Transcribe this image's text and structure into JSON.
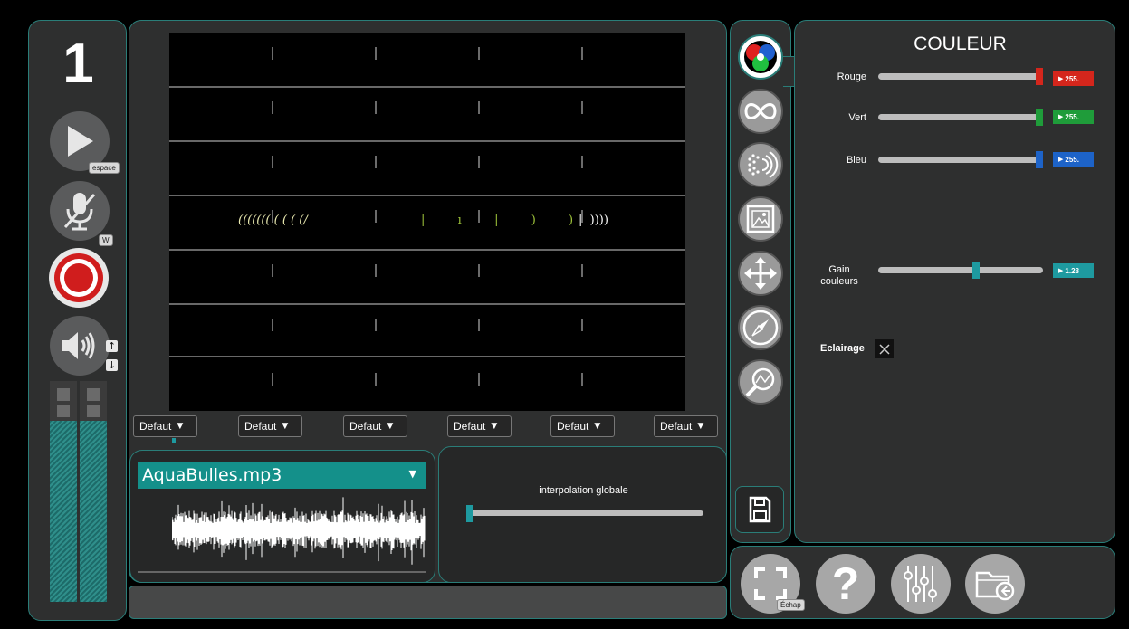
{
  "channel": {
    "number": "1"
  },
  "left_controls": {
    "play_key": "espace",
    "mic_key": "W",
    "volume_up": "↑",
    "volume_down": "↓"
  },
  "dropdowns": [
    {
      "label": "Defaut"
    },
    {
      "label": "Defaut"
    },
    {
      "label": "Defaut"
    },
    {
      "label": "Defaut"
    },
    {
      "label": "Defaut"
    },
    {
      "label": "Defaut"
    }
  ],
  "visualizer": {
    "glyphs": [
      {
        "text": "((((((( ( ( ( (/",
        "color": "#e9e9b0"
      },
      {
        "text": "|  ı  |  )  )",
        "color": "#9ec33a"
      },
      {
        "text": "|  ))))",
        "color": "#ffffff"
      }
    ]
  },
  "audio": {
    "file": "AquaBulles.mp3",
    "interpolation_label": "interpolation globale",
    "interpolation_value": 0.0
  },
  "couleur": {
    "title": "COULEUR",
    "rouge": {
      "label": "Rouge",
      "value": "255.",
      "fraction": 1.0,
      "color": "#d4261c"
    },
    "vert": {
      "label": "Vert",
      "value": "255.",
      "fraction": 1.0,
      "color": "#1f9c3a"
    },
    "bleu": {
      "label": "Bleu",
      "value": "255.",
      "fraction": 1.0,
      "color": "#1d63c8"
    },
    "gain": {
      "label": "Gain couleurs",
      "value": "1.28",
      "fraction": 0.6,
      "color": "#1e9aa0"
    },
    "eclairage": {
      "label": "Eclairage",
      "checked": false
    }
  },
  "bottom_bar": {
    "fullscreen_key": "Échap"
  },
  "icons": [
    "color-wheel-icon",
    "infinity-icon",
    "particles-icon",
    "image-icon",
    "move-icon",
    "compass-icon",
    "magnifier-curve-icon",
    "save-icon",
    "fullscreen-icon",
    "help-icon",
    "mixer-icon",
    "folder-icon"
  ]
}
